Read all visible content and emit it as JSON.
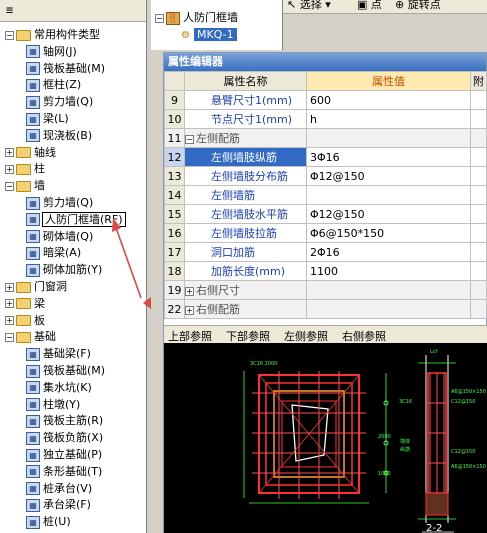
{
  "left_tree": {
    "items": [
      {
        "label": "常用构件类型",
        "level": 0,
        "kind": "folder",
        "expanded": true
      },
      {
        "label": "轴网(J)",
        "level": 1,
        "kind": "item",
        "icon": "axis-grid-icon"
      },
      {
        "label": "筏板基础(M)",
        "level": 1,
        "kind": "item",
        "icon": "raft-foundation-icon"
      },
      {
        "label": "框柱(Z)",
        "level": 1,
        "kind": "item",
        "icon": "frame-column-icon"
      },
      {
        "label": "剪力墙(Q)",
        "level": 1,
        "kind": "item",
        "icon": "shear-wall-icon"
      },
      {
        "label": "梁(L)",
        "level": 1,
        "kind": "item",
        "icon": "beam-icon"
      },
      {
        "label": "现浇板(B)",
        "level": 1,
        "kind": "item",
        "icon": "slab-icon"
      },
      {
        "label": "轴线",
        "level": 0,
        "kind": "folder",
        "expanded": false
      },
      {
        "label": "柱",
        "level": 0,
        "kind": "folder",
        "expanded": false
      },
      {
        "label": "墙",
        "level": 0,
        "kind": "folder",
        "expanded": true
      },
      {
        "label": "剪力墙(Q)",
        "level": 1,
        "kind": "item",
        "icon": "shear-wall-icon"
      },
      {
        "label": "人防门框墙(RF)",
        "level": 1,
        "kind": "item",
        "icon": "civil-defense-door-wall-icon",
        "selected": true
      },
      {
        "label": "砌体墙(Q)",
        "level": 1,
        "kind": "item",
        "icon": "masonry-wall-icon"
      },
      {
        "label": "暗梁(A)",
        "level": 1,
        "kind": "item",
        "icon": "hidden-beam-icon"
      },
      {
        "label": "砌体加筋(Y)",
        "level": 1,
        "kind": "item",
        "icon": "masonry-rebar-icon"
      },
      {
        "label": "门窗洞",
        "level": 0,
        "kind": "folder",
        "expanded": false
      },
      {
        "label": "梁",
        "level": 0,
        "kind": "folder",
        "expanded": false
      },
      {
        "label": "板",
        "level": 0,
        "kind": "folder",
        "expanded": false
      },
      {
        "label": "基础",
        "level": 0,
        "kind": "folder",
        "expanded": true
      },
      {
        "label": "基础梁(F)",
        "level": 1,
        "kind": "item",
        "icon": "foundation-beam-icon"
      },
      {
        "label": "筏板基础(M)",
        "level": 1,
        "kind": "item",
        "icon": "raft-foundation-icon"
      },
      {
        "label": "集水坑(K)",
        "level": 1,
        "kind": "item",
        "icon": "sump-pit-icon"
      },
      {
        "label": "柱墩(Y)",
        "level": 1,
        "kind": "item",
        "icon": "column-pier-icon"
      },
      {
        "label": "筏板主筋(R)",
        "level": 1,
        "kind": "item",
        "icon": "raft-main-rebar-icon"
      },
      {
        "label": "筏板负筋(X)",
        "level": 1,
        "kind": "item",
        "icon": "raft-negative-rebar-icon"
      },
      {
        "label": "独立基础(P)",
        "level": 1,
        "kind": "item",
        "icon": "isolated-foundation-icon"
      },
      {
        "label": "条形基础(T)",
        "level": 1,
        "kind": "item",
        "icon": "strip-foundation-icon"
      },
      {
        "label": "桩承台(V)",
        "level": 1,
        "kind": "item",
        "icon": "pile-cap-icon"
      },
      {
        "label": "承台梁(F)",
        "level": 1,
        "kind": "item",
        "icon": "cap-beam-icon"
      },
      {
        "label": "桩(U)",
        "level": 1,
        "kind": "item",
        "icon": "pile-icon"
      }
    ]
  },
  "component_tree": {
    "root_label": "人防门框墙",
    "child_label": "MKQ-1"
  },
  "toolbar": {
    "select_label": "选择",
    "point_label": "点",
    "rotate_point_label": "旋转点"
  },
  "property_editor": {
    "title": "属性编辑器",
    "col_name": "属性名称",
    "col_value": "属性值",
    "col_extra": "附",
    "rows": [
      {
        "num": "9",
        "name": "悬臂尺寸1(mm)",
        "value": "600",
        "style": "blue"
      },
      {
        "num": "10",
        "name": "节点尺寸1(mm)",
        "value": "h",
        "style": "blue"
      },
      {
        "num": "11",
        "name": "左侧配筋",
        "value": "",
        "style": "group",
        "expander": "−"
      },
      {
        "num": "12",
        "name": "左侧墙肢纵筋",
        "value": "3Φ16",
        "style": "blue",
        "selected": true
      },
      {
        "num": "13",
        "name": "左侧墙肢分布筋",
        "value": "Φ12@150",
        "style": "blue"
      },
      {
        "num": "14",
        "name": "左侧墙筋",
        "value": "",
        "style": "blue"
      },
      {
        "num": "15",
        "name": "左侧墙肢水平筋",
        "value": "Φ12@150",
        "style": "blue"
      },
      {
        "num": "16",
        "name": "左侧墙肢拉筋",
        "value": "Φ6@150*150",
        "style": "blue"
      },
      {
        "num": "17",
        "name": "洞口加筋",
        "value": "2Φ16",
        "style": "blue"
      },
      {
        "num": "18",
        "name": "加筋长度(mm)",
        "value": "1100",
        "style": "blue"
      },
      {
        "num": "19",
        "name": "右侧尺寸",
        "value": "",
        "style": "group",
        "expander": "+"
      },
      {
        "num": "22",
        "name": "右侧配筋",
        "value": "",
        "style": "group",
        "expander": "+"
      }
    ]
  },
  "reference_tabs": [
    "上部参照",
    "下部参照",
    "左侧参照",
    "右侧参照"
  ],
  "cad_preview": {
    "section_label": "2-2",
    "dim_labels": [
      "Lcf",
      "3C16",
      "C12@150",
      "A6@150×150",
      "C12@150",
      "墙体",
      "纵筋",
      "箍筋",
      "水平",
      "分布",
      "3C16",
      "2000",
      "1000",
      "Lcf"
    ]
  },
  "colors": {
    "accent": "#316ac5",
    "property_value_header": "#c05000",
    "link_blue": "#1b3fb8",
    "arrow_red": "#e04848"
  }
}
